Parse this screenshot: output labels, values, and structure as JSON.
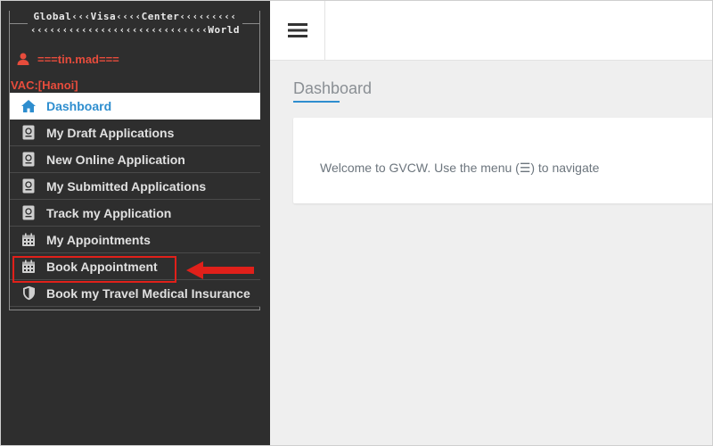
{
  "logo": {
    "line1": "Global‹‹‹Visa‹‹‹‹Center‹‹‹‹‹‹‹‹‹",
    "line2": "‹‹‹‹‹‹‹‹‹‹‹‹‹‹‹‹‹‹‹‹‹‹‹‹‹‹‹‹World"
  },
  "user": {
    "name": "===tin.mad===",
    "icon": "user-icon"
  },
  "vac": "VAC:[Hanoi]",
  "sidebar": {
    "items": [
      {
        "label": "Dashboard",
        "icon": "home-icon",
        "active": true
      },
      {
        "label": "My Draft Applications",
        "icon": "passport-icon"
      },
      {
        "label": "New Online Application",
        "icon": "passport-icon"
      },
      {
        "label": "My Submitted Applications",
        "icon": "passport-icon"
      },
      {
        "label": "Track my Application",
        "icon": "passport-icon"
      },
      {
        "label": "My Appointments",
        "icon": "calendar-icon"
      },
      {
        "label": "Book Appointment",
        "icon": "calendar-icon",
        "highlighted": true
      },
      {
        "label": "Book my Travel Medical Insurance",
        "icon": "shield-icon"
      }
    ]
  },
  "main": {
    "title": "Dashboard",
    "welcome": "Welcome to GVCW. Use the menu (☰) to navigate"
  },
  "colors": {
    "sidebar_bg": "#2e2e2e",
    "accent": "#2e8ecf",
    "danger": "#e74c3c",
    "highlight": "#e0201a"
  }
}
